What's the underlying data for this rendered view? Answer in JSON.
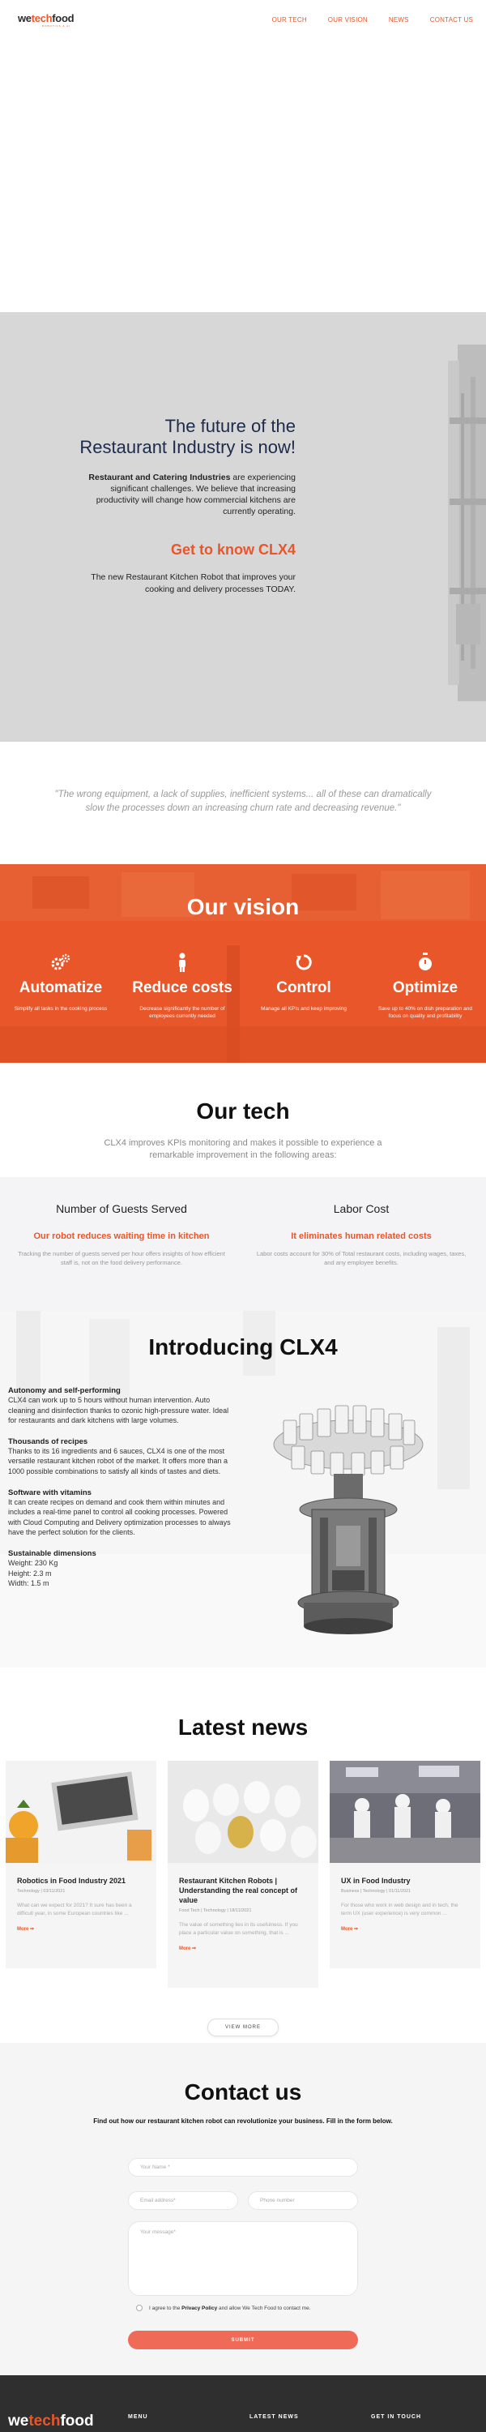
{
  "brand": {
    "we": "we",
    "tech": "tech",
    "food": "food",
    "tagline": "ROBOTICS & AI",
    "accent_color": "#e8562a"
  },
  "nav": [
    "OUR TECH",
    "OUR VISION",
    "NEWS",
    "CONTACT US"
  ],
  "hero": {
    "title": "The future of the Restaurant Industry is now!",
    "p1_bold": "Restaurant and Catering Industries",
    "p1_rest": " are experiencing significant challenges. We believe that increasing productivity will change how commercial kitchens are currently operating.",
    "subtitle": "Get to know CLX4",
    "p2": "The new Restaurant Kitchen Robot that improves your cooking and delivery processes TODAY."
  },
  "quote": "\"The wrong equipment, a lack of supplies, inefficient systems... all of these can dramatically slow the processes down an increasing churn rate and decreasing revenue.\"",
  "vision": {
    "title": "Our vision",
    "items": [
      {
        "icon": "gears-icon",
        "title": "Automatize",
        "text": "Simplify all tasks in the cooking process"
      },
      {
        "icon": "person-icon",
        "title": "Reduce costs",
        "text": "Decrease significantly the number of employees currently needed"
      },
      {
        "icon": "refresh-icon",
        "title": "Control",
        "text": "Manage all KPIs and keep improving"
      },
      {
        "icon": "stopwatch-icon",
        "title": "Optimize",
        "text": "Save up to 40% on dish preparation and focus on quality and profitability"
      }
    ]
  },
  "tech": {
    "title": "Our tech",
    "intro": "CLX4 improves KPIs monitoring and makes it possible to experience a remarkable improvement in the following areas:",
    "cols": [
      {
        "title": "Number of Guests Served",
        "highlight": "Our robot reduces waiting time in kitchen",
        "text": "Tracking the number of guests served per hour offers insights of how efficient staff is, not on the food delivery performance."
      },
      {
        "title": "Labor Cost",
        "highlight": "It eliminates human related costs",
        "text": "Labor costs account for 30% of Total restaurant costs, including wages, taxes, and any employee benefits."
      }
    ]
  },
  "introducing": {
    "title": "Introducing CLX4",
    "specs": [
      {
        "title": "Autonomy and self-performing",
        "text": "CLX4 can work up to 5 hours without human intervention. Auto cleaning and disinfection thanks to ozonic high-pressure water. Ideal for restaurants and dark kitchens with large volumes."
      },
      {
        "title": "Thousands of recipes",
        "text": "Thanks to its 16 ingredients and 6 sauces, CLX4 is one of the most versatile restaurant kitchen robot of the market. It offers more than a 1000 possible combinations to satisfy all kinds of tastes and diets."
      },
      {
        "title": "Software with vitamins",
        "text": "It can create recipes on demand and cook them within minutes and includes a real-time panel to control all cooking processes. Powered with Cloud Computing and Delivery optimization processes to always have the perfect solution for the clients."
      },
      {
        "title": "Sustainable dimensions",
        "lines": [
          "Weight: 230 Kg",
          "Height: 2.3 m",
          "Width: 1.5 m"
        ]
      }
    ]
  },
  "news": {
    "title": "Latest news",
    "cards": [
      {
        "title": "Robotics in Food Industry 2021",
        "meta": "Technology  |  03/11/2021",
        "excerpt": "What can we expect for 2021? It sure has been a difficult year, in some European countries like ...",
        "more": "More ⇒"
      },
      {
        "title": "Restaurant Kitchen Robots | Understanding the real concept of value",
        "meta": "Food Tech  |  Technology  |  18/11/2021",
        "excerpt": "The value of something lies in its usefulness. If you place a particular value on something, that is ...",
        "more": "More ⇒"
      },
      {
        "title": "UX in Food Industry",
        "meta": "Business  |  Technology  |  01/11/2021",
        "excerpt": "For those who work in web design and in tech, the term UX (user experience) is very common ...",
        "more": "More ⇒"
      }
    ],
    "view_more": "VIEW MORE"
  },
  "contact": {
    "title": "Contact us",
    "subtitle": "Find out how our restaurant kitchen robot can revolutionize your business. Fill in the form below.",
    "name_placeholder": "Your Name *",
    "email_placeholder": "Email address*",
    "phone_placeholder": "Phone number",
    "message_placeholder": "Your message*",
    "agree_pre": "I agree to the ",
    "agree_link": "Privacy Policy",
    "agree_post": " and allow We Tech Food to contact me.",
    "submit": "SUBMIT"
  },
  "footer": {
    "menu": "MENU",
    "latest_news": "LATEST NEWS",
    "get_in_touch": "GET IN TOUCH"
  }
}
